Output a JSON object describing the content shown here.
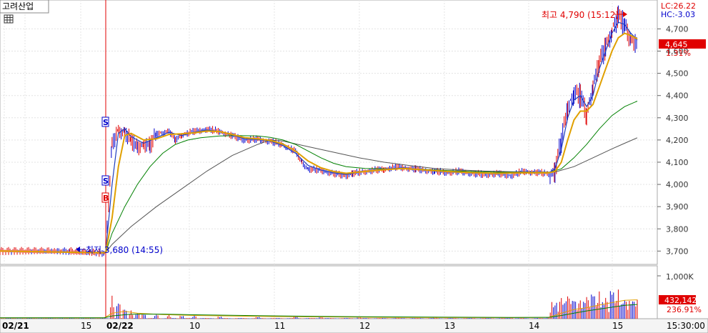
{
  "header": {
    "stock_name": "고려산업",
    "grid_icon": "grid-icon"
  },
  "indicators": {
    "lc": "LC:26.22",
    "hc": "HC:-3.03"
  },
  "price_axis": {
    "ticks": [
      "4,700",
      "4,600",
      "4,500",
      "4,400",
      "4,300",
      "4,200",
      "4,100",
      "4,000",
      "3,900",
      "3,800",
      "3,700"
    ],
    "current_price": "4,645",
    "change_pct": "1.31%"
  },
  "volume_axis": {
    "tick": "1,000K",
    "current_volume": "432,142",
    "volume_pct": "236.91%"
  },
  "time_axis": {
    "labels": [
      "02/21",
      "15",
      "02/22",
      "10",
      "11",
      "12",
      "13",
      "14",
      "15",
      "15:30:00"
    ]
  },
  "annotations": {
    "high": "최고 4,790 (15:12)",
    "low": "최저 3,680 (14:55)",
    "markers": [
      "S",
      "S",
      "B"
    ]
  },
  "colors": {
    "up": "#e00000",
    "down": "#0000cc",
    "ma5": "#0000aa",
    "ma10": "#e0a000",
    "ma20": "#008000",
    "ma60": "#555555",
    "price_tag": "#e00000",
    "separator": "#e00000"
  },
  "chart_data": {
    "type": "line",
    "title": "",
    "ylim": [
      3640,
      4830
    ],
    "volume_ylim": [
      0,
      1150
    ],
    "x_range": [
      0,
      100
    ],
    "series": [
      {
        "key": "price",
        "values": [
          [
            0,
            3700
          ],
          [
            7,
            3703
          ],
          [
            10,
            3700
          ],
          [
            13,
            3696
          ],
          [
            15,
            3690
          ],
          [
            16,
            3710
          ],
          [
            17,
            4180
          ],
          [
            18,
            4250
          ],
          [
            19,
            4240
          ],
          [
            20,
            4200
          ],
          [
            21,
            4170
          ],
          [
            22,
            4190
          ],
          [
            23,
            4175
          ],
          [
            24,
            4230
          ],
          [
            26,
            4240
          ],
          [
            27,
            4200
          ],
          [
            28,
            4225
          ],
          [
            30,
            4240
          ],
          [
            32,
            4250
          ],
          [
            34,
            4240
          ],
          [
            36,
            4220
          ],
          [
            38,
            4200
          ],
          [
            40,
            4205
          ],
          [
            42,
            4195
          ],
          [
            44,
            4180
          ],
          [
            46,
            4150
          ],
          [
            47,
            4100
          ],
          [
            48,
            4070
          ],
          [
            50,
            4065
          ],
          [
            52,
            4050
          ],
          [
            54,
            4040
          ],
          [
            55,
            4050
          ],
          [
            57,
            4060
          ],
          [
            60,
            4070
          ],
          [
            62,
            4080
          ],
          [
            65,
            4070
          ],
          [
            68,
            4060
          ],
          [
            70,
            4055
          ],
          [
            72,
            4060
          ],
          [
            74,
            4050
          ],
          [
            76,
            4045
          ],
          [
            78,
            4050
          ],
          [
            80,
            4040
          ],
          [
            82,
            4060
          ],
          [
            84,
            4055
          ],
          [
            86,
            4050
          ],
          [
            87,
            4065
          ],
          [
            88,
            4200
          ],
          [
            89,
            4350
          ],
          [
            90,
            4420
          ],
          [
            91,
            4400
          ],
          [
            92,
            4320
          ],
          [
            93,
            4450
          ],
          [
            94,
            4550
          ],
          [
            95,
            4620
          ],
          [
            96,
            4700
          ],
          [
            97,
            4760
          ],
          [
            98,
            4720
          ],
          [
            99,
            4660
          ],
          [
            100,
            4645
          ]
        ]
      },
      {
        "key": "ma5",
        "values": [
          [
            0,
            3700
          ],
          [
            15,
            3692
          ],
          [
            16,
            3700
          ],
          [
            17,
            4000
          ],
          [
            18,
            4230
          ],
          [
            19,
            4250
          ],
          [
            20,
            4215
          ],
          [
            22,
            4185
          ],
          [
            24,
            4210
          ],
          [
            26,
            4235
          ],
          [
            28,
            4220
          ],
          [
            30,
            4235
          ],
          [
            32,
            4245
          ],
          [
            34,
            4238
          ],
          [
            36,
            4222
          ],
          [
            38,
            4205
          ],
          [
            40,
            4202
          ],
          [
            42,
            4195
          ],
          [
            44,
            4175
          ],
          [
            46,
            4140
          ],
          [
            48,
            4085
          ],
          [
            50,
            4065
          ],
          [
            52,
            4052
          ],
          [
            54,
            4045
          ],
          [
            56,
            4055
          ],
          [
            60,
            4068
          ],
          [
            63,
            4075
          ],
          [
            66,
            4065
          ],
          [
            70,
            4056
          ],
          [
            74,
            4052
          ],
          [
            78,
            4048
          ],
          [
            82,
            4052
          ],
          [
            86,
            4052
          ],
          [
            87,
            4070
          ],
          [
            88,
            4160
          ],
          [
            89,
            4300
          ],
          [
            90,
            4380
          ],
          [
            91,
            4400
          ],
          [
            92,
            4350
          ],
          [
            93,
            4400
          ],
          [
            94,
            4520
          ],
          [
            95,
            4600
          ],
          [
            96,
            4680
          ],
          [
            97,
            4730
          ],
          [
            98,
            4720
          ],
          [
            99,
            4680
          ],
          [
            100,
            4650
          ]
        ]
      },
      {
        "key": "ma10",
        "values": [
          [
            0,
            3700
          ],
          [
            15,
            3692
          ],
          [
            16,
            3695
          ],
          [
            17,
            3850
          ],
          [
            18,
            4080
          ],
          [
            19,
            4220
          ],
          [
            20,
            4230
          ],
          [
            22,
            4200
          ],
          [
            24,
            4205
          ],
          [
            26,
            4225
          ],
          [
            28,
            4228
          ],
          [
            30,
            4232
          ],
          [
            32,
            4240
          ],
          [
            34,
            4238
          ],
          [
            36,
            4225
          ],
          [
            38,
            4210
          ],
          [
            40,
            4205
          ],
          [
            42,
            4198
          ],
          [
            44,
            4182
          ],
          [
            46,
            4150
          ],
          [
            48,
            4105
          ],
          [
            50,
            4075
          ],
          [
            52,
            4058
          ],
          [
            54,
            4050
          ],
          [
            56,
            4056
          ],
          [
            60,
            4066
          ],
          [
            63,
            4072
          ],
          [
            66,
            4066
          ],
          [
            70,
            4058
          ],
          [
            74,
            4053
          ],
          [
            78,
            4050
          ],
          [
            82,
            4052
          ],
          [
            86,
            4052
          ],
          [
            87,
            4058
          ],
          [
            88,
            4100
          ],
          [
            89,
            4200
          ],
          [
            90,
            4290
          ],
          [
            91,
            4330
          ],
          [
            92,
            4330
          ],
          [
            93,
            4360
          ],
          [
            94,
            4440
          ],
          [
            95,
            4520
          ],
          [
            96,
            4600
          ],
          [
            97,
            4660
          ],
          [
            98,
            4680
          ],
          [
            99,
            4670
          ],
          [
            100,
            4655
          ]
        ]
      },
      {
        "key": "ma20",
        "values": [
          [
            0,
            3700
          ],
          [
            15,
            3693
          ],
          [
            16,
            3694
          ],
          [
            17,
            3780
          ],
          [
            19,
            3900
          ],
          [
            21,
            4000
          ],
          [
            23,
            4080
          ],
          [
            25,
            4140
          ],
          [
            27,
            4180
          ],
          [
            29,
            4200
          ],
          [
            31,
            4210
          ],
          [
            34,
            4218
          ],
          [
            37,
            4220
          ],
          [
            40,
            4218
          ],
          [
            42,
            4212
          ],
          [
            44,
            4200
          ],
          [
            46,
            4180
          ],
          [
            48,
            4150
          ],
          [
            50,
            4120
          ],
          [
            52,
            4095
          ],
          [
            54,
            4080
          ],
          [
            57,
            4072
          ],
          [
            60,
            4070
          ],
          [
            63,
            4070
          ],
          [
            66,
            4068
          ],
          [
            70,
            4062
          ],
          [
            74,
            4058
          ],
          [
            78,
            4055
          ],
          [
            82,
            4054
          ],
          [
            86,
            4054
          ],
          [
            88,
            4070
          ],
          [
            90,
            4120
          ],
          [
            92,
            4180
          ],
          [
            94,
            4250
          ],
          [
            96,
            4310
          ],
          [
            98,
            4350
          ],
          [
            100,
            4375
          ]
        ]
      },
      {
        "key": "ma60",
        "values": [
          [
            0,
            3700
          ],
          [
            15,
            3694
          ],
          [
            16,
            3694
          ],
          [
            17,
            3730
          ],
          [
            20,
            3810
          ],
          [
            24,
            3900
          ],
          [
            28,
            3980
          ],
          [
            32,
            4060
          ],
          [
            36,
            4130
          ],
          [
            40,
            4180
          ],
          [
            42,
            4200
          ],
          [
            44,
            4195
          ],
          [
            48,
            4170
          ],
          [
            52,
            4145
          ],
          [
            56,
            4120
          ],
          [
            60,
            4100
          ],
          [
            64,
            4085
          ],
          [
            68,
            4072
          ],
          [
            72,
            4065
          ],
          [
            76,
            4060
          ],
          [
            80,
            4057
          ],
          [
            84,
            4055
          ],
          [
            87,
            4056
          ],
          [
            90,
            4080
          ],
          [
            93,
            4120
          ],
          [
            96,
            4160
          ],
          [
            98,
            4185
          ],
          [
            100,
            4210
          ]
        ]
      }
    ],
    "volume": {
      "spikes": [
        [
          17,
          500
        ],
        [
          18,
          420
        ],
        [
          19,
          260
        ],
        [
          20,
          180
        ],
        [
          21,
          140
        ],
        [
          22,
          120
        ],
        [
          24,
          100
        ],
        [
          26,
          90
        ],
        [
          28,
          80
        ],
        [
          30,
          70
        ],
        [
          34,
          60
        ],
        [
          40,
          50
        ],
        [
          46,
          60
        ],
        [
          50,
          40
        ],
        [
          56,
          30
        ],
        [
          62,
          25
        ],
        [
          68,
          30
        ],
        [
          74,
          20
        ],
        [
          80,
          25
        ],
        [
          86,
          40
        ],
        [
          88,
          450
        ],
        [
          89,
          600
        ],
        [
          90,
          520
        ],
        [
          91,
          400
        ],
        [
          92,
          560
        ],
        [
          93,
          700
        ],
        [
          94,
          600
        ],
        [
          95,
          520
        ],
        [
          96,
          800
        ],
        [
          97,
          650
        ],
        [
          98,
          450
        ],
        [
          99,
          520
        ],
        [
          100,
          430
        ]
      ],
      "ma_lines": [
        {
          "key": "vma1",
          "values": [
            [
              0,
              20
            ],
            [
              15,
              20
            ],
            [
              17,
              120
            ],
            [
              19,
              160
            ],
            [
              21,
              120
            ],
            [
              25,
              90
            ],
            [
              30,
              70
            ],
            [
              40,
              50
            ],
            [
              50,
              40
            ],
            [
              60,
              30
            ],
            [
              70,
              25
            ],
            [
              80,
              25
            ],
            [
              86,
              30
            ],
            [
              88,
              120
            ],
            [
              90,
              200
            ],
            [
              92,
              240
            ],
            [
              94,
              300
            ],
            [
              96,
              350
            ],
            [
              98,
              400
            ],
            [
              100,
              410
            ]
          ]
        },
        {
          "key": "vma2",
          "values": [
            [
              0,
              20
            ],
            [
              15,
              20
            ],
            [
              17,
              60
            ],
            [
              20,
              100
            ],
            [
              25,
              100
            ],
            [
              30,
              85
            ],
            [
              40,
              65
            ],
            [
              50,
              50
            ],
            [
              60,
              40
            ],
            [
              70,
              32
            ],
            [
              80,
              28
            ],
            [
              86,
              30
            ],
            [
              88,
              70
            ],
            [
              90,
              120
            ],
            [
              92,
              170
            ],
            [
              94,
              210
            ],
            [
              96,
              250
            ],
            [
              98,
              290
            ],
            [
              100,
              310
            ]
          ]
        }
      ]
    }
  }
}
